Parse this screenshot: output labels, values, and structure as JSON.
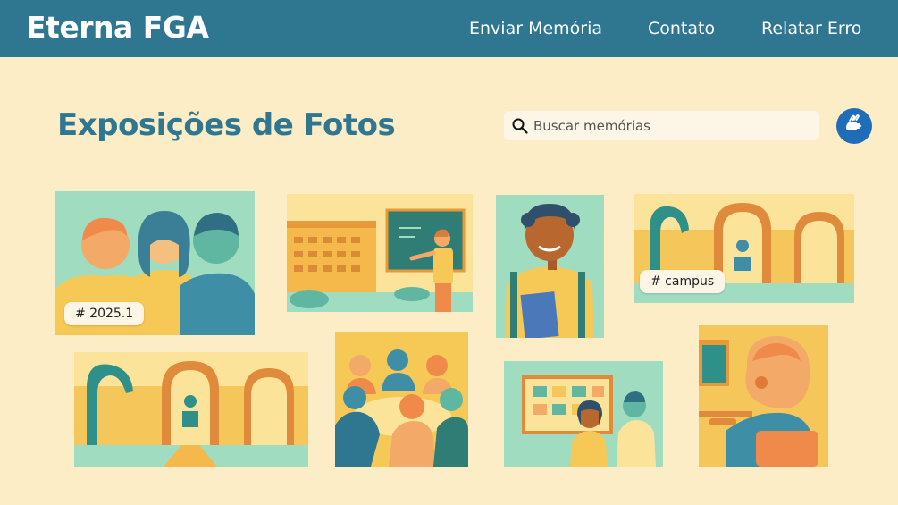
{
  "header": {
    "brand": "Eterna FGA",
    "nav": {
      "send_memory": "Enviar Memória",
      "contact": "Contato",
      "report_error": "Relatar Erro"
    }
  },
  "main": {
    "title": "Exposições de Fotos",
    "search": {
      "placeholder": "Buscar memórias",
      "value": ""
    }
  },
  "gallery": {
    "tags": {
      "semester": "# 2025.1",
      "campus": "# campus"
    }
  },
  "colors": {
    "header_bg": "#2f7791",
    "page_bg": "#fdedc6",
    "title": "#2f7791",
    "accessibility_button": "#1f6db8"
  },
  "icons": {
    "search": "search-icon",
    "accessibility": "sign-language-icon"
  }
}
